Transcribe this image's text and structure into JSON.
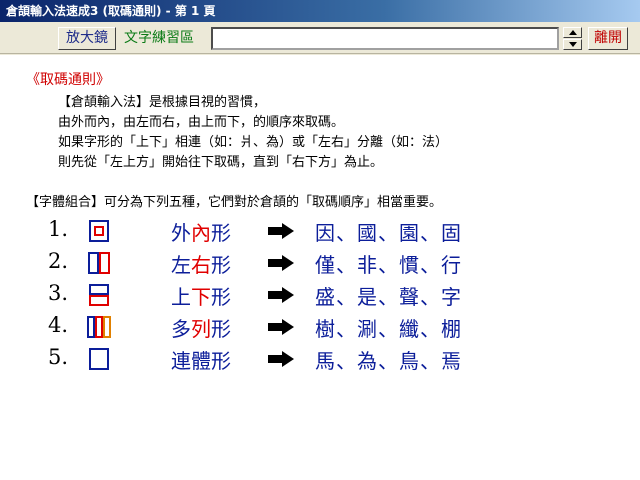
{
  "window": {
    "title": "倉頡輸入法速成3 (取碼通則) - 第 1 頁"
  },
  "toolbar": {
    "magnify_label": "放大鏡",
    "practice_label": "文字練習區",
    "practice_value": "",
    "exit_label": "離開"
  },
  "content": {
    "section_title": "《取碼通則》",
    "paragraphs": [
      "【倉頡輸入法】是根據目視的習慣，",
      "由外而內，由左而右，由上而下，的順序來取碼。",
      "如果字形的「上下」相連（如：爿、為）或「左右」分離（如：法）",
      "則先從「左上方」開始往下取碼，直到「右下方」為止。",
      "【字體組合】可分為下列五種，它們對於倉頡的「取碼順序」相當重要。"
    ],
    "rows": [
      {
        "num": "1.",
        "kind_a": "外",
        "kind_b": "內",
        "kind_c": "形",
        "examples": [
          "因",
          "國",
          "園",
          "固"
        ]
      },
      {
        "num": "2.",
        "kind_a": "左",
        "kind_b": "右",
        "kind_c": "形",
        "examples": [
          "僅",
          "非",
          "慣",
          "行"
        ]
      },
      {
        "num": "3.",
        "kind_a": "上",
        "kind_b": "下",
        "kind_c": "形",
        "examples": [
          "盛",
          "是",
          "聲",
          "字"
        ]
      },
      {
        "num": "4.",
        "kind_a": "多",
        "kind_b": "列",
        "kind_c": "形",
        "examples": [
          "樹",
          "涮",
          "纖",
          "棚"
        ]
      },
      {
        "num": "5.",
        "kind_a": "連",
        "kind_b": "體",
        "kind_c": "形",
        "examples": [
          "馬",
          "為",
          "鳥",
          "焉"
        ]
      }
    ],
    "separator": "、"
  },
  "colors": {
    "primary_text": "#0c1e9a",
    "accent_red": "#e00000",
    "accent_orange": "#e08000",
    "title_red": "#d00000"
  }
}
